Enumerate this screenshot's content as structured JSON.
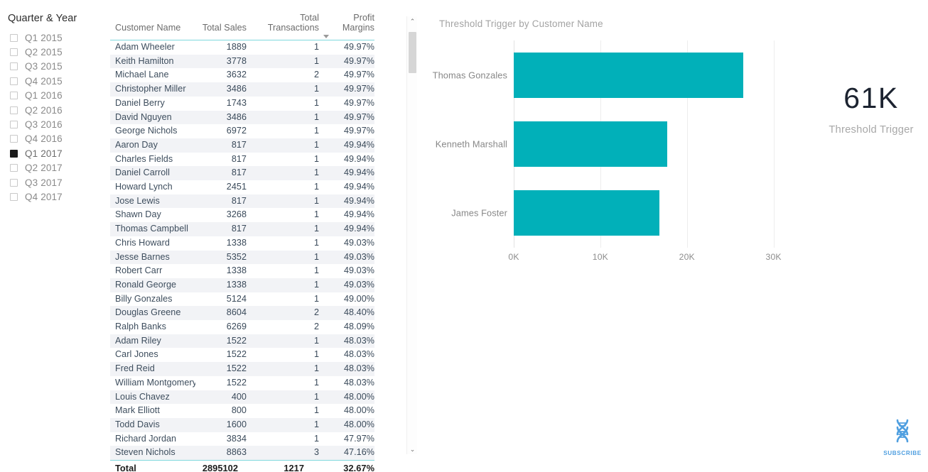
{
  "slicer": {
    "title": "Quarter & Year",
    "items": [
      {
        "label": "Q1 2015",
        "selected": false
      },
      {
        "label": "Q2 2015",
        "selected": false
      },
      {
        "label": "Q3 2015",
        "selected": false
      },
      {
        "label": "Q4 2015",
        "selected": false
      },
      {
        "label": "Q1 2016",
        "selected": false
      },
      {
        "label": "Q2 2016",
        "selected": false
      },
      {
        "label": "Q3 2016",
        "selected": false
      },
      {
        "label": "Q4 2016",
        "selected": false
      },
      {
        "label": "Q1 2017",
        "selected": true
      },
      {
        "label": "Q2 2017",
        "selected": false
      },
      {
        "label": "Q3 2017",
        "selected": false
      },
      {
        "label": "Q4 2017",
        "selected": false
      }
    ]
  },
  "table": {
    "columns": [
      "Customer Name",
      "Total Sales",
      "Total Transactions",
      "Profit Margins"
    ],
    "sort_column": "Profit Margins",
    "sort_direction": "descending",
    "rows": [
      [
        "Adam Wheeler",
        "1889",
        "1",
        "49.97%"
      ],
      [
        "Keith Hamilton",
        "3778",
        "1",
        "49.97%"
      ],
      [
        "Michael Lane",
        "3632",
        "2",
        "49.97%"
      ],
      [
        "Christopher Miller",
        "3486",
        "1",
        "49.97%"
      ],
      [
        "Daniel Berry",
        "1743",
        "1",
        "49.97%"
      ],
      [
        "David Nguyen",
        "3486",
        "1",
        "49.97%"
      ],
      [
        "George Nichols",
        "6972",
        "1",
        "49.97%"
      ],
      [
        "Aaron Day",
        "817",
        "1",
        "49.94%"
      ],
      [
        "Charles Fields",
        "817",
        "1",
        "49.94%"
      ],
      [
        "Daniel Carroll",
        "817",
        "1",
        "49.94%"
      ],
      [
        "Howard Lynch",
        "2451",
        "1",
        "49.94%"
      ],
      [
        "Jose Lewis",
        "817",
        "1",
        "49.94%"
      ],
      [
        "Shawn Day",
        "3268",
        "1",
        "49.94%"
      ],
      [
        "Thomas Campbell",
        "817",
        "1",
        "49.94%"
      ],
      [
        "Chris Howard",
        "1338",
        "1",
        "49.03%"
      ],
      [
        "Jesse Barnes",
        "5352",
        "1",
        "49.03%"
      ],
      [
        "Robert Carr",
        "1338",
        "1",
        "49.03%"
      ],
      [
        "Ronald George",
        "1338",
        "1",
        "49.03%"
      ],
      [
        "Billy Gonzales",
        "5124",
        "1",
        "49.00%"
      ],
      [
        "Douglas Greene",
        "8604",
        "2",
        "48.40%"
      ],
      [
        "Ralph Banks",
        "6269",
        "2",
        "48.09%"
      ],
      [
        "Adam Riley",
        "1522",
        "1",
        "48.03%"
      ],
      [
        "Carl Jones",
        "1522",
        "1",
        "48.03%"
      ],
      [
        "Fred Reid",
        "1522",
        "1",
        "48.03%"
      ],
      [
        "William Montgomery",
        "1522",
        "1",
        "48.03%"
      ],
      [
        "Louis Chavez",
        "400",
        "1",
        "48.00%"
      ],
      [
        "Mark Elliott",
        "800",
        "1",
        "48.00%"
      ],
      [
        "Todd Davis",
        "1600",
        "1",
        "48.00%"
      ],
      [
        "Richard Jordan",
        "3834",
        "1",
        "47.97%"
      ],
      [
        "Steven Nichols",
        "8863",
        "3",
        "47.16%"
      ]
    ],
    "total_row": [
      "Total",
      "2895102",
      "1217",
      "32.67%"
    ]
  },
  "scrollbar": {
    "up_arrow": "⌃",
    "down_arrow": "⌄"
  },
  "kpi": {
    "value": "61K",
    "label": "Threshold Trigger"
  },
  "watermark": {
    "label": "SUBSCRIBE",
    "icon": "dna-helix-icon",
    "color": "#4f9fe0"
  },
  "chart_data": {
    "type": "bar",
    "orientation": "horizontal",
    "title": "Threshold Trigger by Customer Name",
    "categories": [
      "Thomas Gonzales",
      "Kenneth Marshall",
      "James Foster"
    ],
    "values": [
      26500,
      17700,
      16800
    ],
    "xlabel": "",
    "ylabel": "",
    "xlim": [
      0,
      32000
    ],
    "xticks": [
      0,
      10000,
      20000,
      30000
    ],
    "xticklabels": [
      "0K",
      "10K",
      "20K",
      "30K"
    ],
    "grid": true,
    "legend": false,
    "bar_color": "#01b0b9"
  }
}
